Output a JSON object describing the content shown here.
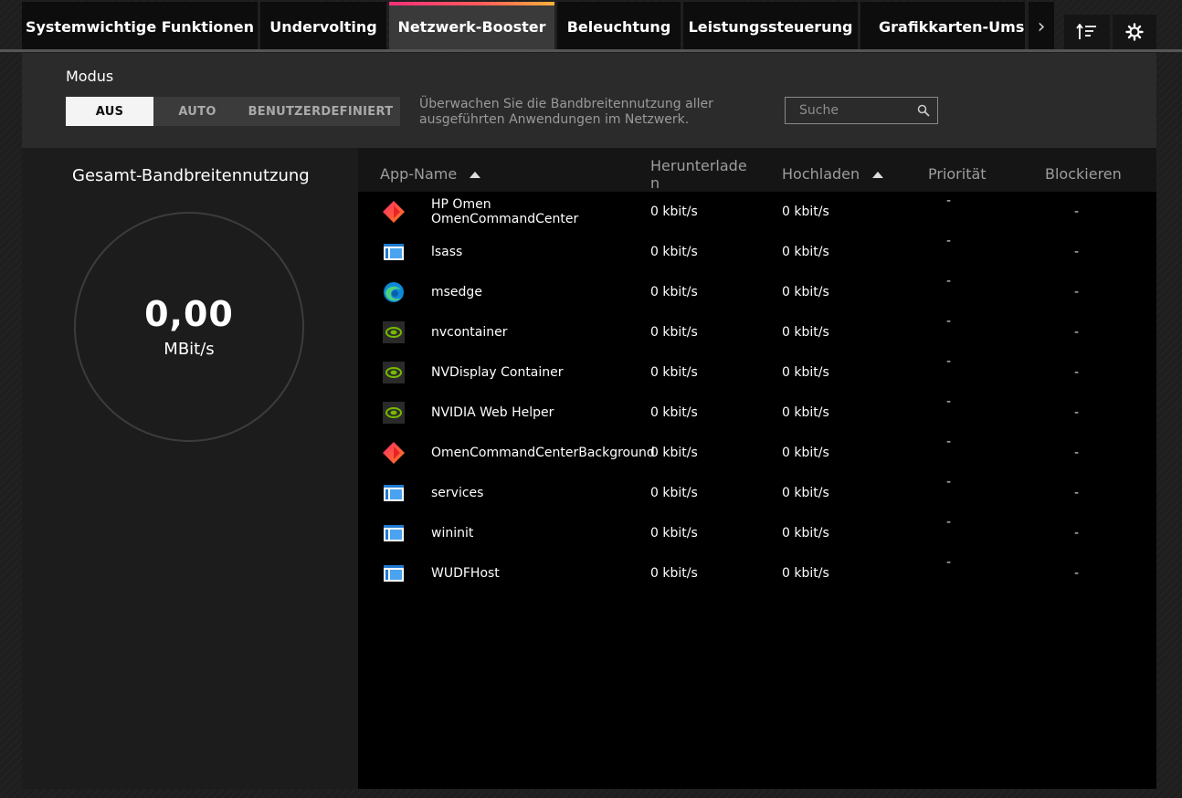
{
  "tabs": [
    {
      "label": "Systemwichtige Funktionen",
      "active": false
    },
    {
      "label": "Undervolting",
      "active": false
    },
    {
      "label": "Netzwerk-Booster",
      "active": true
    },
    {
      "label": "Beleuchtung",
      "active": false
    },
    {
      "label": "Leistungssteuerung",
      "active": false
    },
    {
      "label": "Grafikkarten-Umschaltung",
      "active": false
    }
  ],
  "mode": {
    "label": "Modus",
    "options": [
      "AUS",
      "AUTO",
      "BENUTZERDEFINIERT"
    ],
    "selected": "AUS",
    "description": "Überwachen Sie die Bandbreitennutzung aller ausgeführten Anwendungen im Netzwerk.",
    "search_placeholder": "Suche"
  },
  "bandwidth": {
    "title": "Gesamt-Bandbreitennutzung",
    "value": "0,00",
    "unit": "MBit/s"
  },
  "table": {
    "headers": {
      "app": "App-Name",
      "download": "Herunterladen",
      "upload": "Hochladen",
      "priority": "Priorität",
      "block": "Blockieren"
    },
    "rows": [
      {
        "icon": "omen-icon",
        "name": "HP Omen OmenCommandCenter",
        "download": "0 kbit/s",
        "upload": "0 kbit/s",
        "priority": "-",
        "block": "-"
      },
      {
        "icon": "app-window-icon",
        "name": "lsass",
        "download": "0 kbit/s",
        "upload": "0 kbit/s",
        "priority": "-",
        "block": "-"
      },
      {
        "icon": "edge-icon",
        "name": "msedge",
        "download": "0 kbit/s",
        "upload": "0 kbit/s",
        "priority": "-",
        "block": "-"
      },
      {
        "icon": "nvidia-icon",
        "name": "nvcontainer",
        "download": "0 kbit/s",
        "upload": "0 kbit/s",
        "priority": "-",
        "block": "-"
      },
      {
        "icon": "nvidia-icon",
        "name": "NVDisplay Container",
        "download": "0 kbit/s",
        "upload": "0 kbit/s",
        "priority": "-",
        "block": "-"
      },
      {
        "icon": "nvidia-icon",
        "name": "NVIDIA Web Helper",
        "download": "0 kbit/s",
        "upload": "0 kbit/s",
        "priority": "-",
        "block": "-"
      },
      {
        "icon": "omen-icon",
        "name": "OmenCommandCenterBackground",
        "download": "0 kbit/s",
        "upload": "0 kbit/s",
        "priority": "-",
        "block": "-"
      },
      {
        "icon": "app-window-icon",
        "name": "services",
        "download": "0 kbit/s",
        "upload": "0 kbit/s",
        "priority": "-",
        "block": "-"
      },
      {
        "icon": "app-window-icon",
        "name": "wininit",
        "download": "0 kbit/s",
        "upload": "0 kbit/s",
        "priority": "-",
        "block": "-"
      },
      {
        "icon": "app-window-icon",
        "name": "WUDFHost",
        "download": "0 kbit/s",
        "upload": "0 kbit/s",
        "priority": "-",
        "block": "-"
      }
    ]
  },
  "colors": {
    "accent_gradient": [
      "#f3307a",
      "#ffb13b"
    ],
    "nvidia_green": "#76b900",
    "edge_blue": "#0c8ad8"
  }
}
